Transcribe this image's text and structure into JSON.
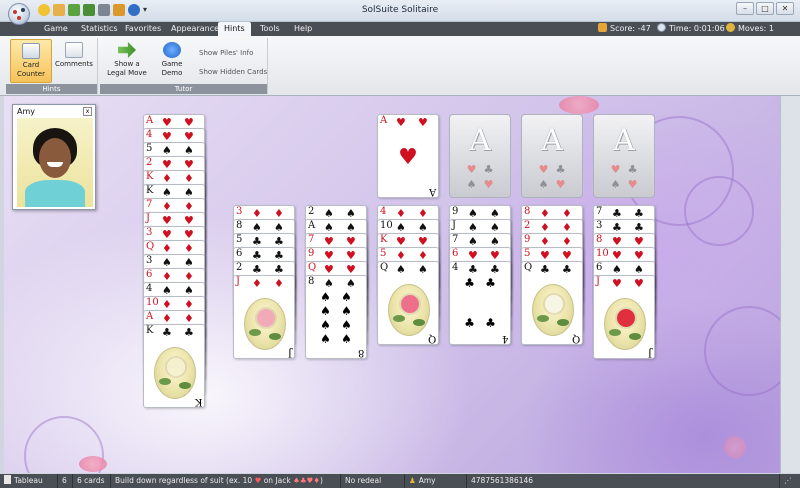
{
  "window": {
    "title": "SolSuite Solitaire"
  },
  "menu": {
    "items": [
      {
        "label": "Game",
        "active": false
      },
      {
        "label": "Statistics",
        "active": false
      },
      {
        "label": "Favorites",
        "active": false
      },
      {
        "label": "Appearance",
        "active": false
      },
      {
        "label": "Hints",
        "active": true
      },
      {
        "label": "Tools",
        "active": false
      },
      {
        "label": "Help",
        "active": false
      }
    ],
    "score": "Score: -47",
    "time": "Time: 0:01:06",
    "moves": "Moves: 1"
  },
  "ribbon": {
    "groups": {
      "hints_label": "Hints",
      "tutor_label": "Tutor"
    },
    "buttons": {
      "card_counter": "Card Counter",
      "comments": "Comments",
      "show_legal_move": "Show a Legal Move",
      "game_demo": "Game Demo",
      "show_piles_info": "Show Piles' Info",
      "show_hidden_cards": "Show Hidden Cards"
    }
  },
  "player": {
    "name": "Amy",
    "close": "x"
  },
  "game": {
    "stock": [
      {
        "rank": "A",
        "suit": "♥",
        "color": "red"
      },
      {
        "rank": "4",
        "suit": "♥",
        "color": "red"
      },
      {
        "rank": "5",
        "suit": "♠",
        "color": "black"
      },
      {
        "rank": "2",
        "suit": "♥",
        "color": "red"
      },
      {
        "rank": "K",
        "suit": "♦",
        "color": "red"
      },
      {
        "rank": "K",
        "suit": "♠",
        "color": "black"
      },
      {
        "rank": "7",
        "suit": "♦",
        "color": "red"
      },
      {
        "rank": "J",
        "suit": "♥",
        "color": "red"
      },
      {
        "rank": "3",
        "suit": "♥",
        "color": "red"
      },
      {
        "rank": "Q",
        "suit": "♦",
        "color": "red"
      },
      {
        "rank": "3",
        "suit": "♠",
        "color": "black"
      },
      {
        "rank": "6",
        "suit": "♦",
        "color": "red"
      },
      {
        "rank": "4",
        "suit": "♠",
        "color": "black"
      },
      {
        "rank": "10",
        "suit": "♦",
        "color": "red"
      },
      {
        "rank": "A",
        "suit": "♦",
        "color": "red"
      },
      {
        "rank": "K",
        "suit": "♣",
        "color": "black",
        "face": true,
        "bloom": "#f4f0d0"
      }
    ],
    "foundations": [
      {
        "rank": "A",
        "suit": "♥",
        "color": "red",
        "filled": true
      },
      {
        "label": "A",
        "filled": false
      },
      {
        "label": "A",
        "filled": false
      },
      {
        "label": "A",
        "filled": false
      }
    ],
    "tableau": [
      {
        "cards": [
          {
            "rank": "3",
            "suit": "♦",
            "color": "red"
          },
          {
            "rank": "8",
            "suit": "♠",
            "color": "black"
          },
          {
            "rank": "5",
            "suit": "♣",
            "color": "black"
          },
          {
            "rank": "6",
            "suit": "♣",
            "color": "black"
          },
          {
            "rank": "2",
            "suit": "♣",
            "color": "black"
          },
          {
            "rank": "J",
            "suit": "♦",
            "color": "red",
            "face": true,
            "bloom": "#f2a9b8"
          }
        ]
      },
      {
        "cards": [
          {
            "rank": "2",
            "suit": "♠",
            "color": "black"
          },
          {
            "rank": "A",
            "suit": "♠",
            "color": "black"
          },
          {
            "rank": "7",
            "suit": "♥",
            "color": "red"
          },
          {
            "rank": "9",
            "suit": "♥",
            "color": "red"
          },
          {
            "rank": "Q",
            "suit": "♥",
            "color": "red"
          },
          {
            "rank": "8",
            "suit": "♠",
            "color": "black",
            "pips": 8
          }
        ]
      },
      {
        "cards": [
          {
            "rank": "4",
            "suit": "♦",
            "color": "red"
          },
          {
            "rank": "10",
            "suit": "♠",
            "color": "black"
          },
          {
            "rank": "K",
            "suit": "♥",
            "color": "red"
          },
          {
            "rank": "5",
            "suit": "♦",
            "color": "red"
          },
          {
            "rank": "Q",
            "suit": "♠",
            "color": "black",
            "face": true,
            "bloom": "#ec6f8c"
          }
        ]
      },
      {
        "cards": [
          {
            "rank": "9",
            "suit": "♠",
            "color": "black"
          },
          {
            "rank": "J",
            "suit": "♠",
            "color": "black"
          },
          {
            "rank": "7",
            "suit": "♠",
            "color": "black"
          },
          {
            "rank": "6",
            "suit": "♥",
            "color": "red"
          },
          {
            "rank": "4",
            "suit": "♣",
            "color": "black",
            "pips": 4
          }
        ]
      },
      {
        "cards": [
          {
            "rank": "8",
            "suit": "♦",
            "color": "red"
          },
          {
            "rank": "2",
            "suit": "♦",
            "color": "red"
          },
          {
            "rank": "9",
            "suit": "♦",
            "color": "red"
          },
          {
            "rank": "5",
            "suit": "♥",
            "color": "red"
          },
          {
            "rank": "Q",
            "suit": "♣",
            "color": "black",
            "face": true,
            "bloom": "#f7f5e6"
          }
        ]
      },
      {
        "cards": [
          {
            "rank": "7",
            "suit": "♣",
            "color": "black"
          },
          {
            "rank": "3",
            "suit": "♣",
            "color": "black"
          },
          {
            "rank": "8",
            "suit": "♥",
            "color": "red"
          },
          {
            "rank": "10",
            "suit": "♥",
            "color": "red"
          },
          {
            "rank": "6",
            "suit": "♠",
            "color": "black"
          },
          {
            "rank": "J",
            "suit": "♥",
            "color": "red",
            "face": true,
            "bloom": "#e0303f"
          }
        ]
      }
    ]
  },
  "statusbar": {
    "pile": "Tableau",
    "count": "6",
    "cards": "6 cards",
    "rule_prefix": "Build down regardless of suit (ex. 10",
    "rule_mid": "on Jack",
    "rule_suffix": ")",
    "redeal": "No redeal",
    "player": "Amy",
    "game_number": "4787561386146"
  },
  "colors": {
    "accent_hover": "#f6c25a",
    "menubar": "#4a4f56",
    "red_suit": "#d01020"
  }
}
